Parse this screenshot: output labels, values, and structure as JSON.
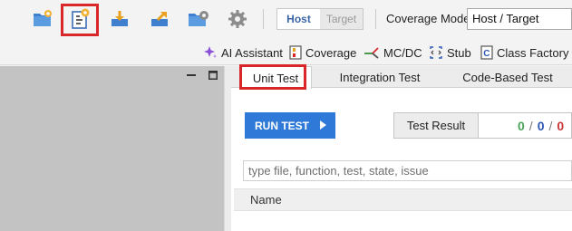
{
  "toolbar": {
    "icons": [
      "new-folder-icon",
      "new-test-icon",
      "import-icon",
      "export-icon",
      "folder-settings-icon",
      "gear-icon"
    ],
    "env_toggle": {
      "host": "Host",
      "target": "Target",
      "selected": "Host"
    },
    "coverage_mode_label": "Coverage Mode",
    "coverage_mode_value": "Host / Target"
  },
  "secondary_toolbar": {
    "ai_assistant": "AI Assistant",
    "coverage": "Coverage",
    "mcdc": "MC/DC",
    "stub": "Stub",
    "class_factory": "Class Factory"
  },
  "tabs": [
    {
      "label": "Unit Test",
      "active": true
    },
    {
      "label": "Integration Test",
      "active": false
    },
    {
      "label": "Code-Based Test",
      "active": false
    }
  ],
  "run_test_label": "RUN TEST",
  "test_result": {
    "label": "Test Result",
    "passed": "0",
    "total": "0",
    "failed": "0"
  },
  "search": {
    "placeholder": "type file, function, test, state, issue"
  },
  "table": {
    "columns": [
      "Name"
    ]
  },
  "colors": {
    "accent": "#2f7ad8",
    "highlight": "#d9262b",
    "pass": "#49a35a",
    "fail": "#c93636"
  }
}
